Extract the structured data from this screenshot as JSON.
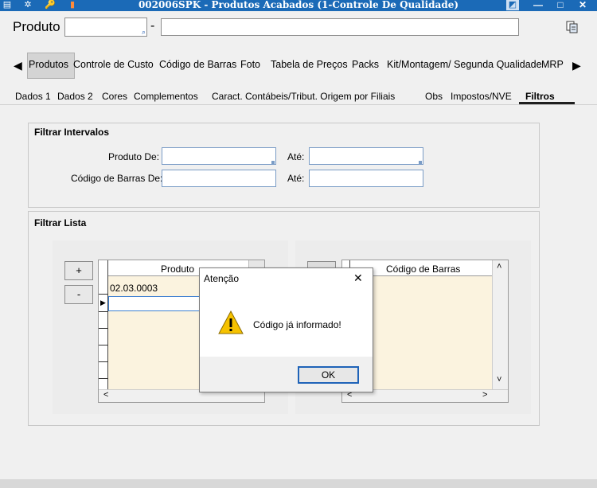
{
  "window": {
    "title": "002006SPK - Produtos Acabados (1-Controle De Qualidade)",
    "minimize": "—",
    "maximize": "□",
    "close": "✕"
  },
  "header": {
    "product_label": "Produto",
    "code_value": "",
    "dash": "-",
    "description_value": ""
  },
  "tabs": [
    {
      "label": "Produtos",
      "active": true
    },
    {
      "label": "Controle de Custo"
    },
    {
      "label": "Código de Barras"
    },
    {
      "label": "Foto"
    },
    {
      "label": "Tabela de Preços"
    },
    {
      "label": "Packs"
    },
    {
      "label": "Kit/Montagem/ Segunda Qualidade"
    },
    {
      "label": "MRP"
    }
  ],
  "subtabs": [
    {
      "label": "Dados 1"
    },
    {
      "label": "Dados 2"
    },
    {
      "label": "Cores"
    },
    {
      "label": "Complementos"
    },
    {
      "label": "Caract. Contábeis/Tribut. Origem por Filiais"
    },
    {
      "label": "Obs"
    },
    {
      "label": "Impostos/NVE"
    },
    {
      "label": "Filtros",
      "active": true
    }
  ],
  "intervals": {
    "title": "Filtrar Intervalos",
    "product_from_label": "Produto De:",
    "to_label": "Até:",
    "barcode_from_label": "Código de Barras De:",
    "to_label_2": "Até:"
  },
  "list_filter": {
    "title": "Filtrar Lista",
    "add_label": "+",
    "remove_label": "-",
    "product_column": "Produto",
    "product_rows": [
      "02.03.0003",
      ""
    ],
    "barcode_column": "Código de Barras"
  },
  "dialog": {
    "title": "Atenção",
    "message": "Código já informado!",
    "ok_label": "OK",
    "close_label": "✕"
  },
  "colors": {
    "titlebar": "#1b6ab7",
    "grid_bg": "#fbf3df",
    "warning": "#f6c200"
  }
}
